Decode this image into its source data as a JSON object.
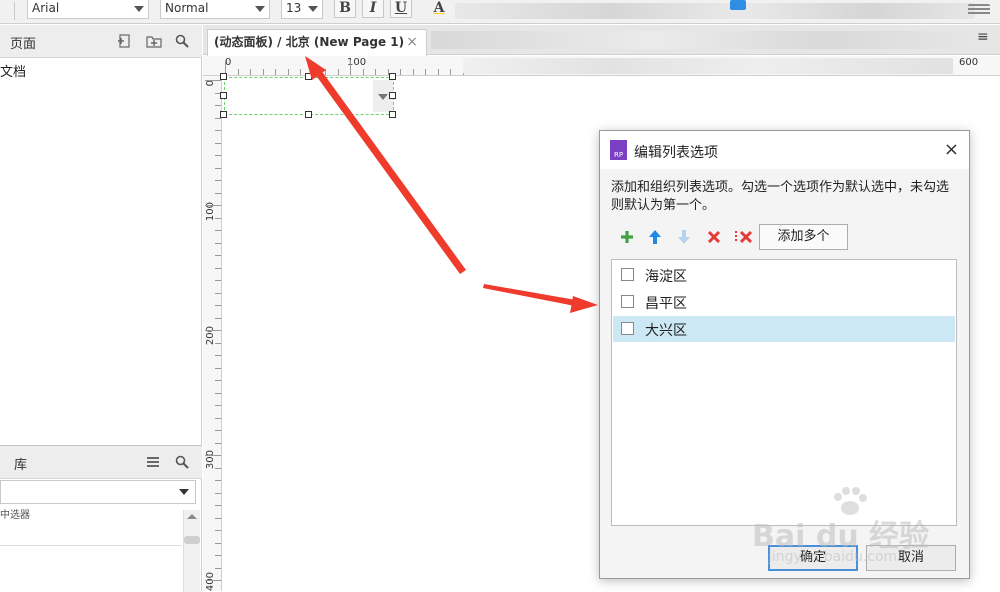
{
  "toolbar": {
    "font_family": "Arial",
    "font_style": "Normal",
    "font_size": "13",
    "bold": "B",
    "italic": "I",
    "underline": "U",
    "text_color": "A"
  },
  "pages_panel": {
    "title": "页面",
    "first_item": "文档"
  },
  "library_panel": {
    "title": "库",
    "list_item": "中选器"
  },
  "tab": {
    "label": "(动态面板) / 北京 (New Page 1)",
    "close": "×"
  },
  "ruler": {
    "top_labels": [
      "0",
      "100",
      "600"
    ],
    "left_labels": [
      "0",
      "100",
      "200",
      "300",
      "400"
    ]
  },
  "dialog": {
    "title": "编辑列表选项",
    "logo_text": "RP",
    "close": "×",
    "description": "添加和组织列表选项。勾选一个选项作为默认选中，未勾选则默认为第一个。",
    "add_multiple": "添加多个",
    "items": [
      {
        "label": "海淀区",
        "checked": false,
        "selected": false
      },
      {
        "label": "昌平区",
        "checked": false,
        "selected": false
      },
      {
        "label": "大兴区",
        "checked": false,
        "selected": true
      }
    ],
    "ok": "确定",
    "cancel": "取消"
  },
  "watermark": {
    "brand": "Bai du 经验",
    "url": "jingyan.baidu.com"
  },
  "colors": {
    "annotation_arrow": "#ef3b2c",
    "selected_row": "#cce8f4",
    "add_icon": "#43a047",
    "up_icon": "#1e88e5",
    "delete_icon": "#e53935",
    "widget_outline": "#6cd36c"
  },
  "icons": {
    "add": "plus-icon",
    "move_up": "arrow-up-icon",
    "move_down": "arrow-down-icon",
    "delete": "delete-icon",
    "delete_all": "delete-all-icon"
  }
}
